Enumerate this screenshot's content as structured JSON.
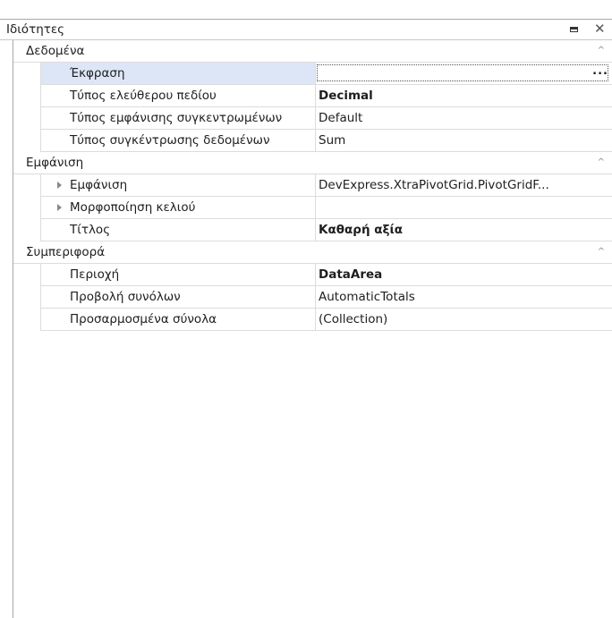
{
  "panel": {
    "title": "Ιδιότητες"
  },
  "categories": [
    {
      "label": "Δεδομένα",
      "props": [
        {
          "name": "Έκφραση",
          "value": "",
          "bold": false,
          "selected": true,
          "expandable": false,
          "has_button": true,
          "button_label": "..."
        },
        {
          "name": "Τύπος ελεύθερου πεδίου",
          "value": "Decimal",
          "bold": true,
          "selected": false,
          "expandable": false,
          "has_button": false
        },
        {
          "name": "Τύπος εμφάνισης συγκεντρωμένων",
          "value": "Default",
          "bold": false,
          "selected": false,
          "expandable": false,
          "has_button": false
        },
        {
          "name": "Τύπος συγκέντρωσης δεδομένων",
          "value": "Sum",
          "bold": false,
          "selected": false,
          "expandable": false,
          "has_button": false
        }
      ]
    },
    {
      "label": "Εμφάνιση",
      "props": [
        {
          "name": "Εμφάνιση",
          "value": "DevExpress.XtraPivotGrid.PivotGridF...",
          "bold": false,
          "selected": false,
          "expandable": true,
          "has_button": false
        },
        {
          "name": "Μορφοποίηση κελιού",
          "value": "",
          "bold": false,
          "selected": false,
          "expandable": true,
          "has_button": false
        },
        {
          "name": "Τίτλος",
          "value": "Καθαρή αξία",
          "bold": true,
          "selected": false,
          "expandable": false,
          "has_button": false
        }
      ]
    },
    {
      "label": "Συμπεριφορά",
      "props": [
        {
          "name": "Περιοχή",
          "value": "DataArea",
          "bold": true,
          "selected": false,
          "expandable": false,
          "has_button": false
        },
        {
          "name": "Προβολή συνόλων",
          "value": "AutomaticTotals",
          "bold": false,
          "selected": false,
          "expandable": false,
          "has_button": false
        },
        {
          "name": "Προσαρμοσμένα σύνολα",
          "value": "(Collection)",
          "bold": false,
          "selected": false,
          "expandable": false,
          "has_button": false
        }
      ]
    }
  ],
  "icons": {
    "restore": "restore-icon",
    "close": "close-icon",
    "collapse": "chevron-up-icon",
    "expand": "triangle-right-icon"
  },
  "colors": {
    "selected_row": "#dde6f7",
    "grid_line": "#dcdcdc"
  }
}
